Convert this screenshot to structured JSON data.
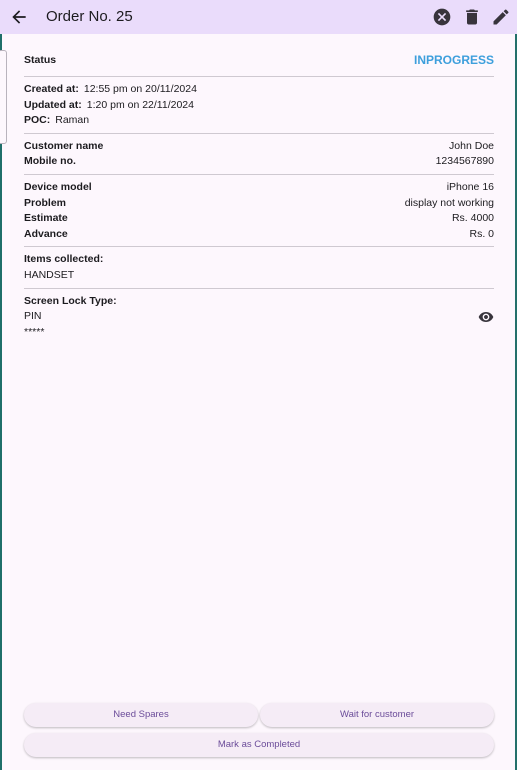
{
  "app_bar": {
    "title": "Order No. 25"
  },
  "status": {
    "label": "Status",
    "value": "INPROGRESS",
    "color": "#3d9fdc"
  },
  "meta": {
    "created_label": "Created at:",
    "created_value": "12:55 pm on 20/11/2024",
    "updated_label": "Updated at:",
    "updated_value": "1:20 pm on 22/11/2024",
    "poc_label": "POC:",
    "poc_value": "Raman"
  },
  "customer": {
    "name_label": "Customer name",
    "name_value": "John Doe",
    "mobile_label": "Mobile no.",
    "mobile_value": "1234567890"
  },
  "device": {
    "model_label": "Device model",
    "model_value": "iPhone 16",
    "problem_label": "Problem",
    "problem_value": "display not working",
    "estimate_label": "Estimate",
    "estimate_value": "Rs. 4000",
    "advance_label": "Advance",
    "advance_value": "Rs. 0"
  },
  "items": {
    "label": "Items collected:",
    "value": "HANDSET"
  },
  "screen_lock": {
    "label": "Screen Lock Type:",
    "type": "PIN",
    "value": "*****"
  },
  "actions": {
    "need_spares": "Need Spares",
    "wait_customer": "Wait for customer",
    "mark_completed": "Mark as Completed"
  },
  "colors": {
    "app_bar": "#eadcfb",
    "background": "#fdf7fd",
    "button_text": "#6b4c99",
    "accent_status": "#3d9fdc"
  },
  "icons": [
    "arrow-back-icon",
    "cancel-icon",
    "delete-icon",
    "edit-icon",
    "eye-icon"
  ]
}
